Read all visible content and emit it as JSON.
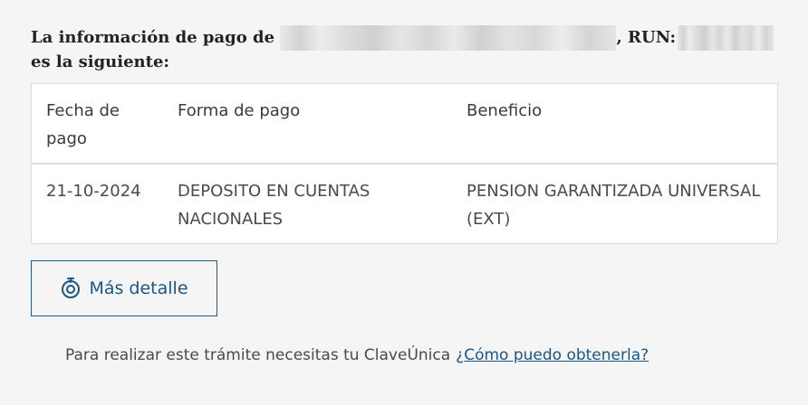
{
  "intro": {
    "prefix": "La información de pago de",
    "run_label": ", RUN:",
    "line2": "es la siguiente:"
  },
  "table": {
    "headers": [
      "Fecha de pago",
      "Forma de pago",
      "Beneficio"
    ],
    "rows": [
      {
        "fecha": "21-10-2024",
        "forma": "DEPOSITO EN CUENTAS NACIONALES",
        "beneficio": "PENSION GARANTIZADA UNIVERSAL (EXT)"
      }
    ]
  },
  "detail_button": {
    "label": "Más detalle",
    "icon": "target-icon",
    "color": "#1a5585"
  },
  "footer": {
    "text": "Para realizar este trámite necesitas tu ClaveÚnica",
    "link": "¿Cómo puedo obtenerla?"
  }
}
